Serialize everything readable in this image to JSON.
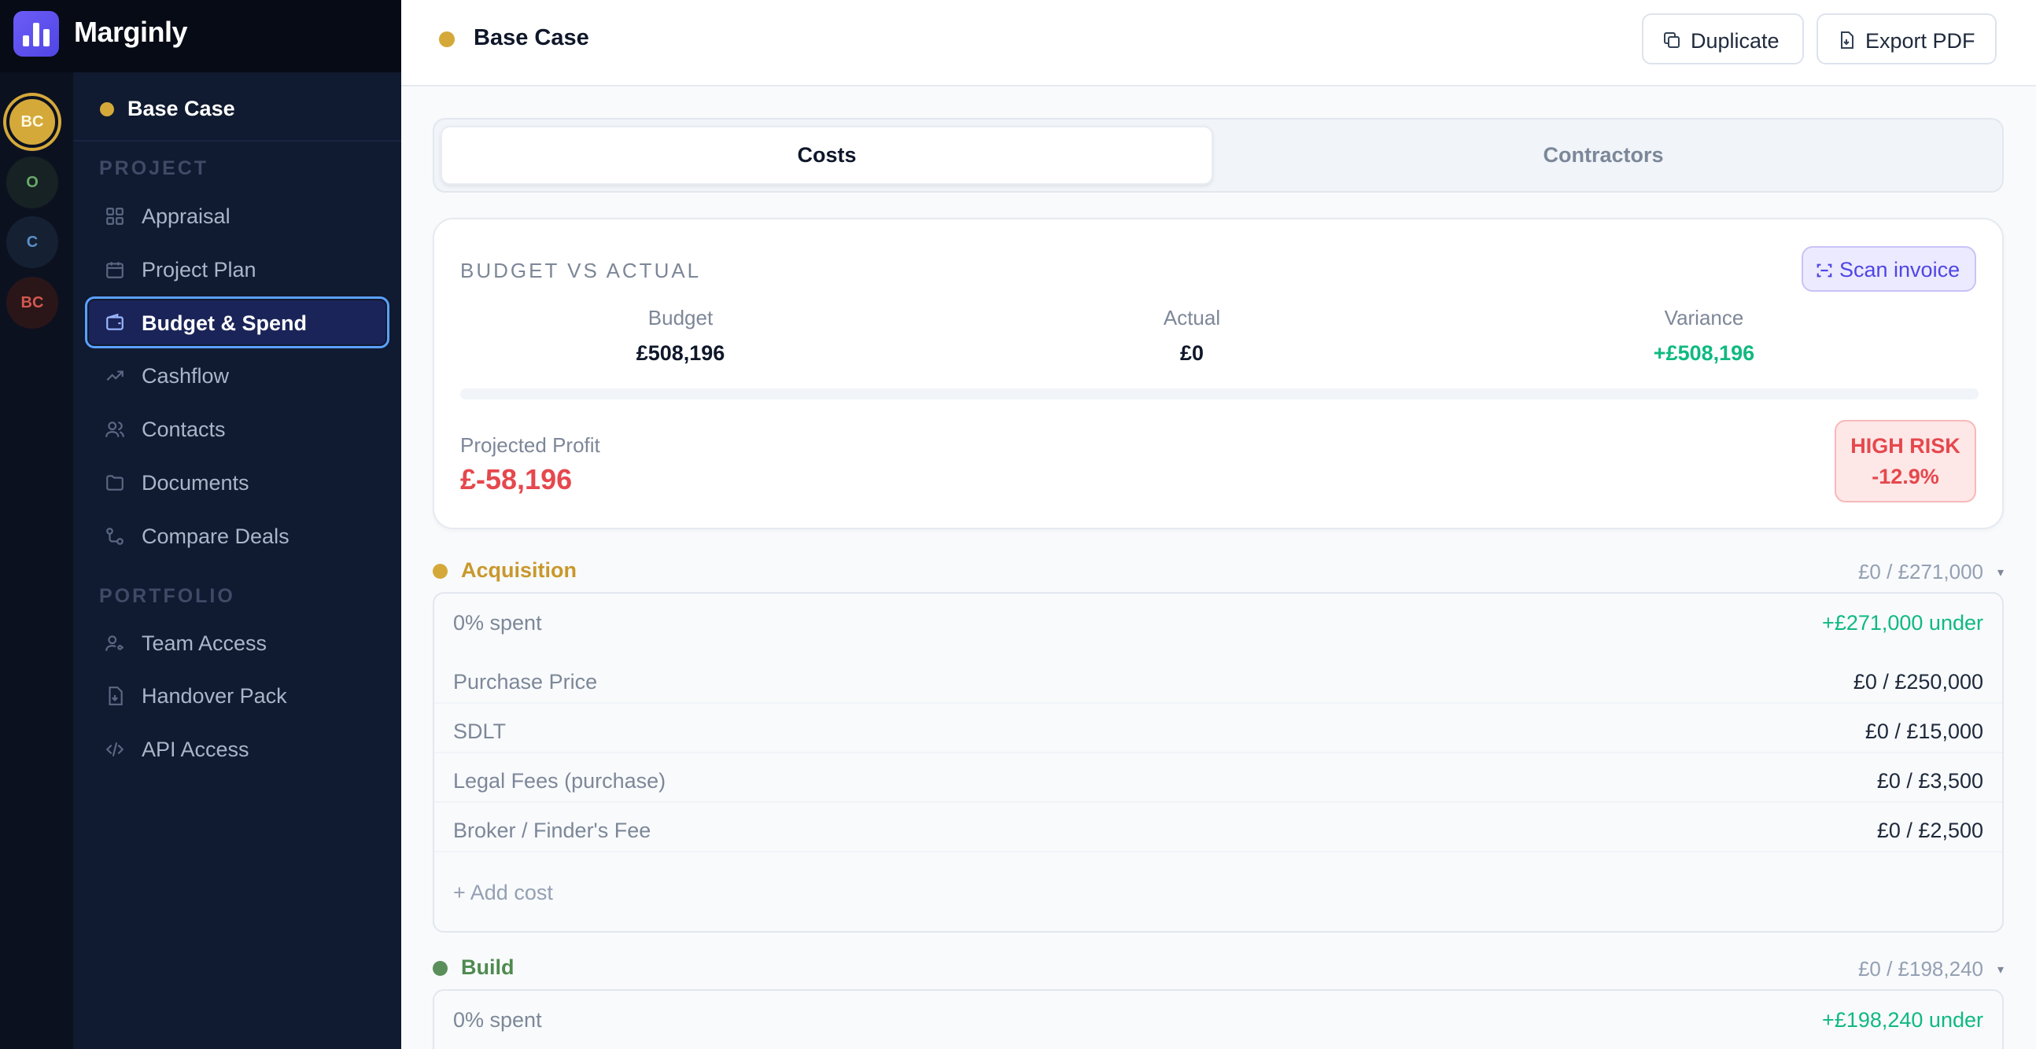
{
  "brand": {
    "name": "Marginly"
  },
  "rail": {
    "avatars": [
      "BC",
      "O",
      "C",
      "BC"
    ]
  },
  "sidebar": {
    "project_name": "Base Case",
    "section_project": "PROJECT",
    "section_portfolio": "PORTFOLIO",
    "items": [
      {
        "label": "Appraisal",
        "icon": "grid-icon"
      },
      {
        "label": "Project Plan",
        "icon": "calendar-icon"
      },
      {
        "label": "Budget & Spend",
        "icon": "wallet-icon",
        "active": true
      },
      {
        "label": "Cashflow",
        "icon": "trend-icon"
      },
      {
        "label": "Contacts",
        "icon": "users-icon"
      },
      {
        "label": "Documents",
        "icon": "folder-icon"
      },
      {
        "label": "Compare Deals",
        "icon": "compare-icon"
      }
    ],
    "portfolio_items": [
      {
        "label": "Team Access",
        "icon": "user-key-icon"
      },
      {
        "label": "Handover Pack",
        "icon": "file-download-icon"
      },
      {
        "label": "API Access",
        "icon": "code-icon"
      }
    ]
  },
  "header": {
    "title": "Base Case",
    "duplicate_label": "Duplicate",
    "export_label": "Export PDF"
  },
  "tabs": {
    "costs": "Costs",
    "contractors": "Contractors"
  },
  "budget": {
    "title": "BUDGET VS ACTUAL",
    "scan_label": "Scan invoice",
    "budget_label": "Budget",
    "budget_value": "£508,196",
    "actual_label": "Actual",
    "actual_value": "£0",
    "variance_label": "Variance",
    "variance_value": "+£508,196",
    "profit_label": "Projected Profit",
    "profit_value": "£-58,196",
    "risk_title": "HIGH RISK",
    "risk_pct": "-12.9%",
    "spent_fraction": 0
  },
  "groups": {
    "acquisition": {
      "name": "Acquisition",
      "total": "£0 / £271,000",
      "spent": "0% spent",
      "under": "+£271,000 under",
      "rows": [
        {
          "label": "Purchase Price",
          "value": "£0 / £250,000"
        },
        {
          "label": "SDLT",
          "value": "£0 / £15,000"
        },
        {
          "label": "Legal Fees (purchase)",
          "value": "£0 / £3,500"
        },
        {
          "label": "Broker / Finder's Fee",
          "value": "£0 / £2,500"
        }
      ],
      "add_cost": "+ Add cost"
    },
    "build": {
      "name": "Build",
      "total": "£0 / £198,240",
      "spent": "0% spent",
      "under": "+£198,240 under"
    },
    "caret": "▾"
  },
  "colors": {
    "accent": "#4f46e5",
    "gold": "#d4a93a",
    "green": "#10b981",
    "red": "#e5484d",
    "build": "#5a8f5a"
  }
}
